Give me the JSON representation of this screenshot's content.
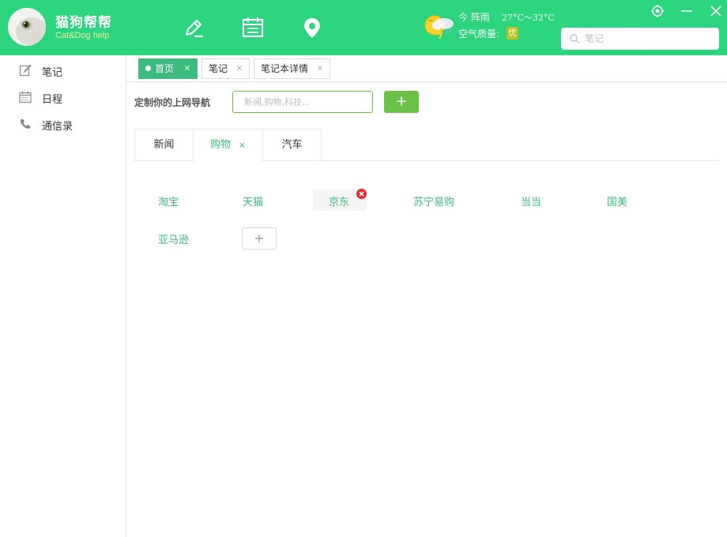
{
  "header": {
    "brand_title": "猫狗帮帮",
    "brand_subtitle": "Cat&Dog help",
    "nav_icons": [
      "edit-icon",
      "calendar-icon",
      "location-icon"
    ],
    "weather": {
      "icon": "thunder-rain-icon",
      "today": "今 阵雨",
      "temperature": "27°C～32°C",
      "air_quality_label": "空气质量:",
      "air_quality_value": "优"
    },
    "window_controls": [
      "skin-icon",
      "minimize-icon",
      "close-icon"
    ],
    "search": {
      "placeholder": "笔记",
      "value": ""
    },
    "colors": {
      "header_bg": "#2bd47d",
      "accent": "#3dba7d",
      "button_green": "#6cc04a"
    }
  },
  "sidebar": {
    "items": [
      {
        "label": "笔记",
        "icon": "edit-icon"
      },
      {
        "label": "日程",
        "icon": "calendar-icon"
      },
      {
        "label": "通信录",
        "icon": "phone-icon"
      }
    ]
  },
  "page_tabs": [
    {
      "label": "首页",
      "active": true,
      "close": "×"
    },
    {
      "label": "笔记",
      "active": false,
      "close": "×"
    },
    {
      "label": "笔记本详情",
      "active": false,
      "close": "×"
    }
  ],
  "customize": {
    "label": "定制你的上网导航",
    "placeholder": "新闻,购物,科技...",
    "add_label": "+"
  },
  "categories": {
    "tabs": [
      {
        "label": "新闻",
        "active": false
      },
      {
        "label": "购物",
        "active": true,
        "close": "×"
      },
      {
        "label": "汽车",
        "active": false
      }
    ]
  },
  "links": {
    "items": [
      "淘宝",
      "天猫",
      "京东",
      "苏宁易购",
      "当当",
      "国美",
      "亚马逊"
    ],
    "hovered": "京东",
    "add_label": "+"
  }
}
